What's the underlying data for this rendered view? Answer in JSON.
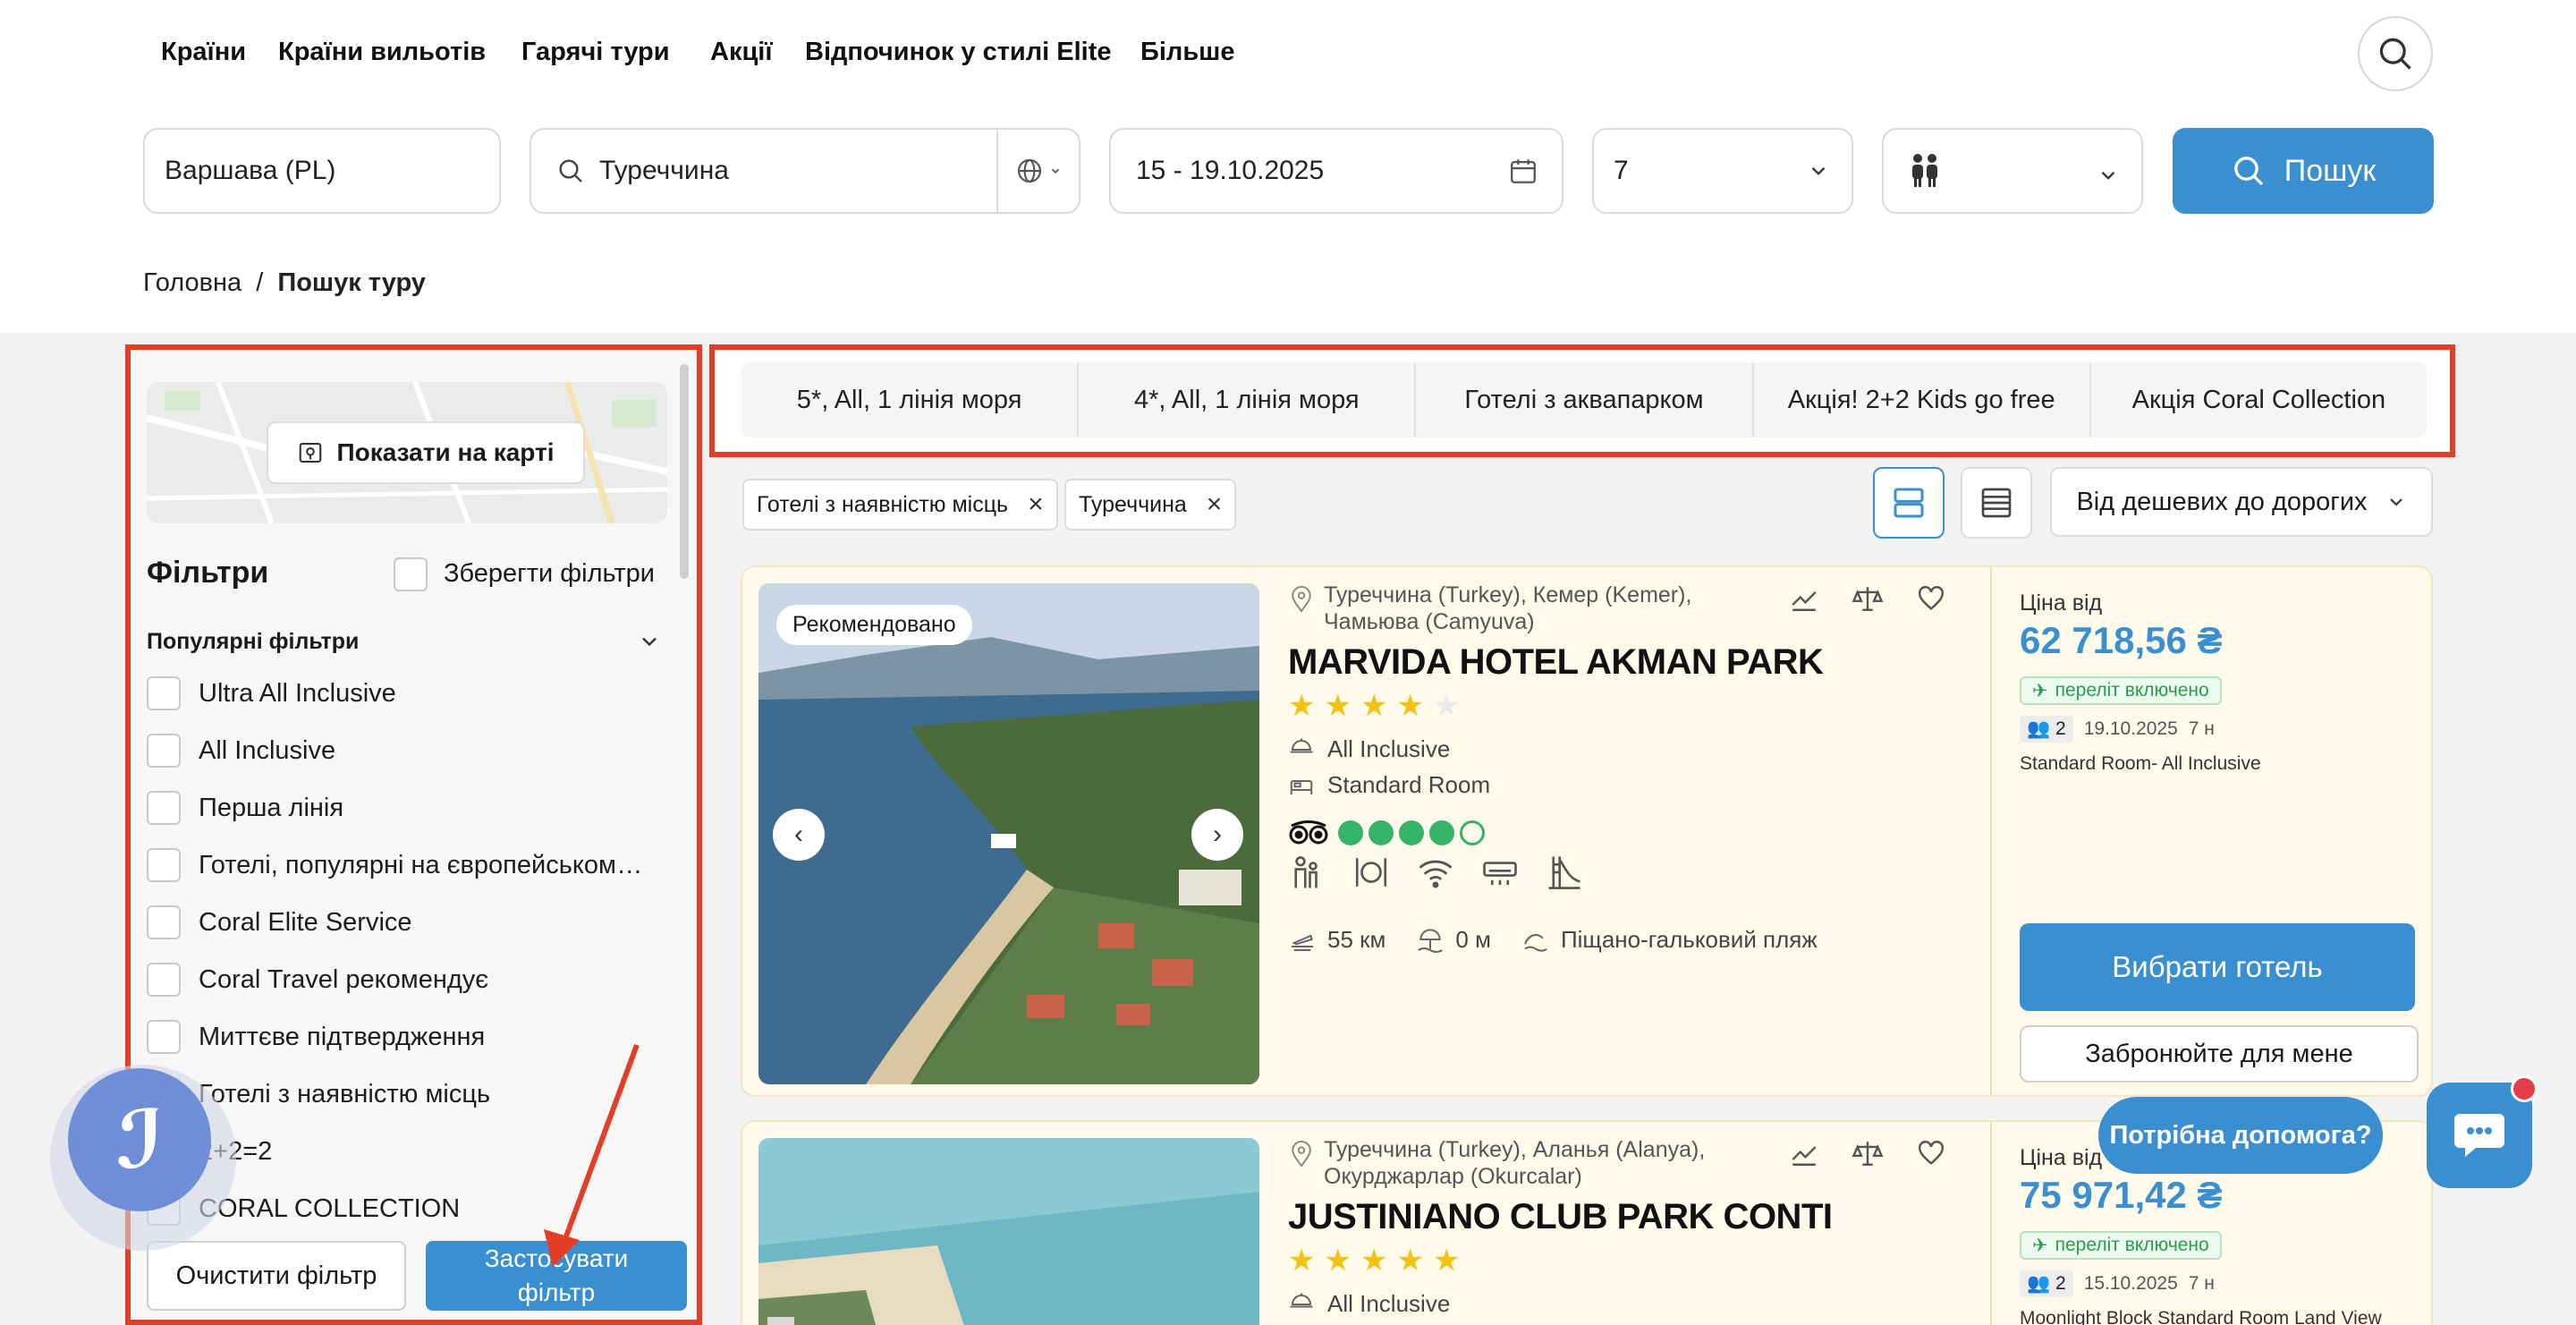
{
  "nav": {
    "items": [
      "Країни",
      "Країни вильотів",
      "Гарячі тури",
      "Акції",
      "Відпочинок у стилі Elite",
      "Більше"
    ]
  },
  "search": {
    "from": "Варшава (PL)",
    "destination": "Туреччина",
    "dates": "15 - 19.10.2025",
    "nights": "7",
    "button": "Пошук"
  },
  "breadcrumb": {
    "home": "Головна",
    "separator": "/",
    "current": "Пошук туру"
  },
  "sidebar": {
    "map_button": "Показати на карті",
    "filters_title": "Фільтри",
    "save_filters": "Зберегти фільтри",
    "popular_title": "Популярні фільтри",
    "items": [
      "Ultra All Inclusive",
      "All Inclusive",
      "Перша лінія",
      "Готелі, популярні на європейському ринку",
      "Coral Elite Service",
      "Coral Travel рекомендує",
      "Миттєве підтвердження",
      "Готелі з наявністю місць",
      "2+2=2",
      "CORAL COLLECTION"
    ],
    "clear_button": "Очистити фільтр",
    "apply_button": "Застосувати фільтр"
  },
  "quick_filters": [
    "5*, All, 1 лінія моря",
    "4*, All, 1 лінія моря",
    "Готелі з аквапарком",
    "Акція! 2+2 Kids go free",
    "Акція Coral Collection"
  ],
  "active_chips": [
    "Готелі з наявністю місць",
    "Туреччина"
  ],
  "sort": {
    "label": "Від дешевих до дорогих"
  },
  "hotels": [
    {
      "badge": "Рекомендовано",
      "location": "Туреччина (Turkey), Кемер (Kemer), Чамьюва (Camyuva)",
      "name": "MARVIDA HOTEL AKMAN PARK",
      "stars": 4,
      "board": "All Inclusive",
      "room_type": "Standard Room",
      "tripadvisor_rating": 4,
      "airport_distance": "55 км",
      "beach_distance": "0 м",
      "beach_type": "Піщано-гальковий пляж",
      "price_label": "Ціна від",
      "price": "62 718,56 ₴",
      "flight_badge": "переліт включено",
      "pax": "2",
      "date": "19.10.2025",
      "nights": "7 н",
      "room_board": "Standard Room- All Inclusive",
      "choose_button": "Вибрати готель",
      "book_button": "Забронюйте для мене"
    },
    {
      "location": "Туреччина (Turkey), Аланья (Alanya), Окурджарлар (Okurcalar)",
      "name": "JUSTINIANO CLUB PARK CONTI",
      "stars": 5,
      "board": "All Inclusive",
      "price_label": "Ціна від",
      "price": "75 971,42 ₴",
      "flight_badge": "переліт включено",
      "pax": "2",
      "date": "15.10.2025",
      "nights": "7 н",
      "room_board": "Moonlight Block Standard Room Land View"
    }
  ],
  "help": {
    "label": "Потрібна допомога?"
  },
  "colors": {
    "accent": "#3a8fd0",
    "highlight": "#e53e27",
    "card_bg": "#fffaea",
    "star": "#f2c313",
    "tripadvisor": "#34b468"
  }
}
